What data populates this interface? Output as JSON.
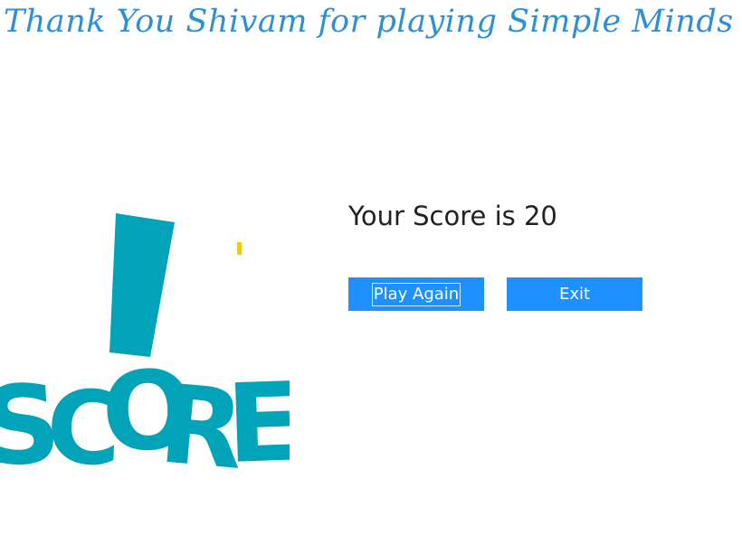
{
  "header": {
    "title": "Thank You Shivam for playing Simple Minds"
  },
  "score_art": {
    "text": "SCORE",
    "icon": "exclamation-score-icon",
    "color": "#00a3b8",
    "accent": "#f2c811"
  },
  "result": {
    "score_text": "Your Score is 20"
  },
  "actions": {
    "play_again_label": "Play Again",
    "exit_label": "Exit",
    "button_color": "#1e90ff"
  }
}
